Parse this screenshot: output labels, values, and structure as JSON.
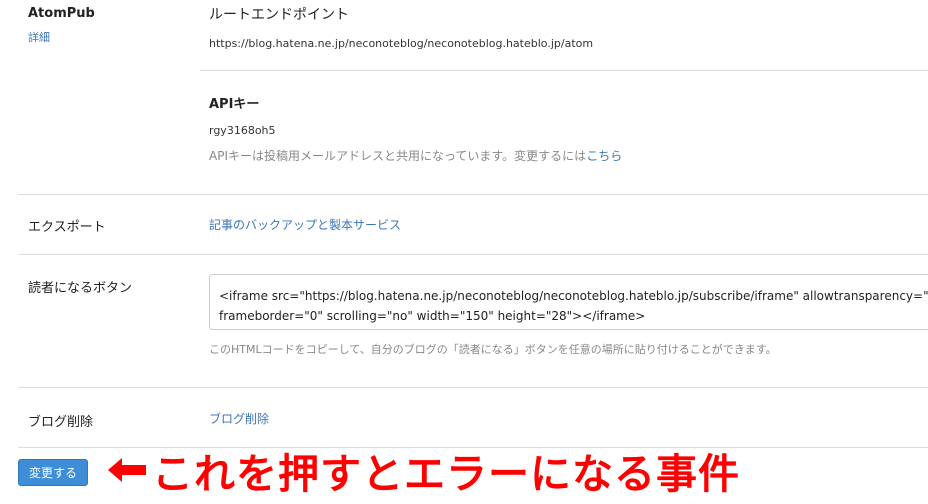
{
  "atompub": {
    "label": "AtomPub",
    "detail_link": "詳細",
    "root_endpoint_heading": "ルートエンドポイント",
    "root_endpoint_url": "https://blog.hatena.ne.jp/neconoteblog/neconoteblog.hateblo.jp/atom",
    "api_key_heading": "APIキー",
    "api_key_value": "rgy3168oh5",
    "api_key_note": "APIキーは投稿用メールアドレスと共用になっています。変更するには",
    "api_key_note_link": "こちら"
  },
  "export": {
    "label": "エクスポート",
    "link": "記事のバックアップと製本サービス"
  },
  "subscribe_button": {
    "label": "読者になるボタン",
    "code_line1": "<iframe src=\"https://blog.hatena.ne.jp/neconoteblog/neconoteblog.hateblo.jp/subscribe/iframe\" allowtransparency=\"true\"",
    "code_line2": "frameborder=\"0\" scrolling=\"no\" width=\"150\" height=\"28\"></iframe>",
    "note": "このHTMLコードをコピーして、自分のブログの「読者になる」ボタンを任意の場所に貼り付けることができます。"
  },
  "blog_delete": {
    "label": "ブログ削除",
    "link": "ブログ削除"
  },
  "submit_button": "変更する",
  "annotation": {
    "text": "これを押すとエラーになる事件",
    "color": "#ff0000"
  }
}
